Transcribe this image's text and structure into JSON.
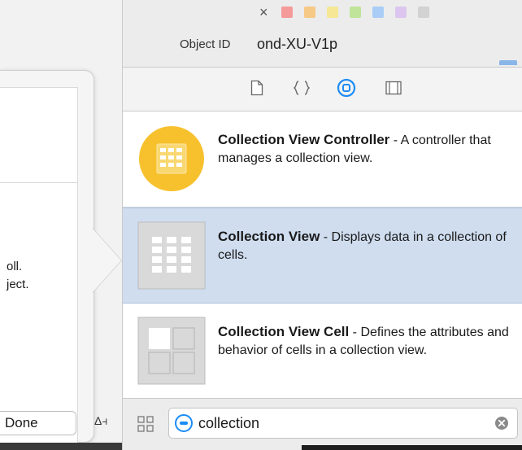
{
  "popover": {
    "text_line1": "oll.",
    "text_line2": "ject.",
    "done_label": "Done",
    "delta_symbol": "Δ⫞"
  },
  "inspector": {
    "close_symbol": "×",
    "label_colors": [
      "#f26b6b",
      "#f5b14a",
      "#f3e06a",
      "#9fd86b",
      "#7fb8f5",
      "#c9a6e6",
      "#bdbdbd"
    ],
    "object_id_label": "Object ID",
    "object_id_value": "ond-XU-V1p",
    "accent_color": "#1c8cf5"
  },
  "tabs": [
    {
      "icon": "file-icon",
      "active": false
    },
    {
      "icon": "braces-icon",
      "active": false
    },
    {
      "icon": "object-library-icon",
      "active": true
    },
    {
      "icon": "media-library-icon",
      "active": false
    }
  ],
  "library": {
    "items": [
      {
        "name": "Collection View Controller",
        "description": " - A controller that manages a collection view.",
        "icon": "collection-view-controller-icon",
        "selected": false
      },
      {
        "name": "Collection View",
        "description": " - Displays data in a collection of cells.",
        "icon": "collection-view-icon",
        "selected": true
      },
      {
        "name": "Collection View Cell",
        "description": " - Defines the attributes and behavior of cells in a collection view.",
        "icon": "collection-view-cell-icon",
        "selected": false
      }
    ]
  },
  "search": {
    "value": "collection",
    "filter_icon": "filter-icon",
    "clear_icon": "clear-icon"
  }
}
